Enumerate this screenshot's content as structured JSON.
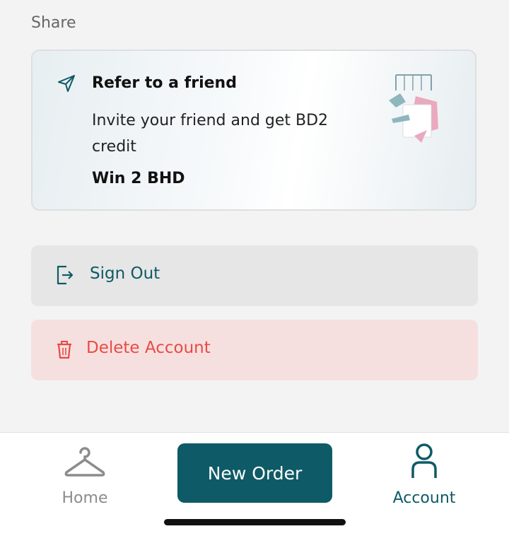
{
  "section": {
    "title": "Share"
  },
  "refer": {
    "title": "Refer to a friend",
    "description": "Invite your friend and get BD2 credit",
    "reward": "Win 2 BHD",
    "icon": "send-icon",
    "illustration": "clothes-rack-illustration"
  },
  "actions": {
    "sign_out": {
      "label": "Sign Out",
      "icon": "sign-out-icon"
    },
    "delete_account": {
      "label": "Delete Account",
      "icon": "trash-icon"
    }
  },
  "tabbar": {
    "home": {
      "label": "Home",
      "icon": "hanger-icon"
    },
    "new_order": {
      "label": "New Order"
    },
    "account": {
      "label": "Account",
      "icon": "person-icon"
    }
  },
  "colors": {
    "accent": "#0e5a66",
    "danger": "#e84a45",
    "danger_background": "#f6e0df",
    "background": "#f3f3f3"
  }
}
